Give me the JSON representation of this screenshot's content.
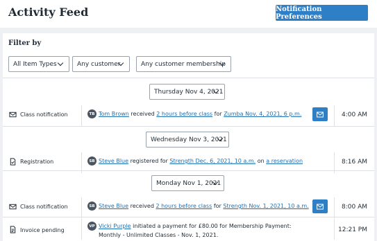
{
  "header": {
    "title": "Activity Feed",
    "notification_button": "Notification Preferences"
  },
  "filters": {
    "heading": "Filter by",
    "item_types": "All Item Types",
    "customer": "Any customer",
    "membership": "Any customer membership"
  },
  "colors": {
    "accent": "#2f7fc6",
    "link": "#1f6fb2",
    "avatar": "#4a5560"
  },
  "groups": [
    {
      "date": "Thursday Nov 4, 2021",
      "rows": [
        {
          "type": "Class notification",
          "icon": "envelope-icon",
          "initials": "TB",
          "name": "Tom Brown",
          "verb": "received",
          "link1": "2 hours before class",
          "mid": "for",
          "link2": "Zumba Nov. 4, 2021, 6 p.m.",
          "time": "4:00 AM"
        }
      ]
    },
    {
      "date": "Wednesday Nov 3, 2021",
      "rows": [
        {
          "type": "Registration",
          "icon": "document-check-icon",
          "initials": "SB",
          "name": "Steve Blue",
          "verb": "registered for",
          "link1": "Strength Dec. 6, 2021, 10 a.m.",
          "mid": "on",
          "link2": "a reservation",
          "time": "8:16 AM"
        }
      ]
    },
    {
      "date": "Monday Nov 1, 2021",
      "rows": [
        {
          "type": "Class notification",
          "icon": "envelope-icon",
          "initials": "SB",
          "name": "Steve Blue",
          "verb": "received",
          "link1": "2 hours before class",
          "mid": "for",
          "link2": "Strength Nov. 1, 2021, 10 a.m.",
          "time": "8:00 AM"
        },
        {
          "type": "Invoice pending",
          "icon": "invoice-icon",
          "initials": "VP",
          "name": "Vicki Purple",
          "text": "initiated a payment for £80.00 for Membership Payment: Monthly - Unlimited Classes - Nov. 1, 2021.",
          "time": "12:21 PM"
        }
      ]
    }
  ]
}
